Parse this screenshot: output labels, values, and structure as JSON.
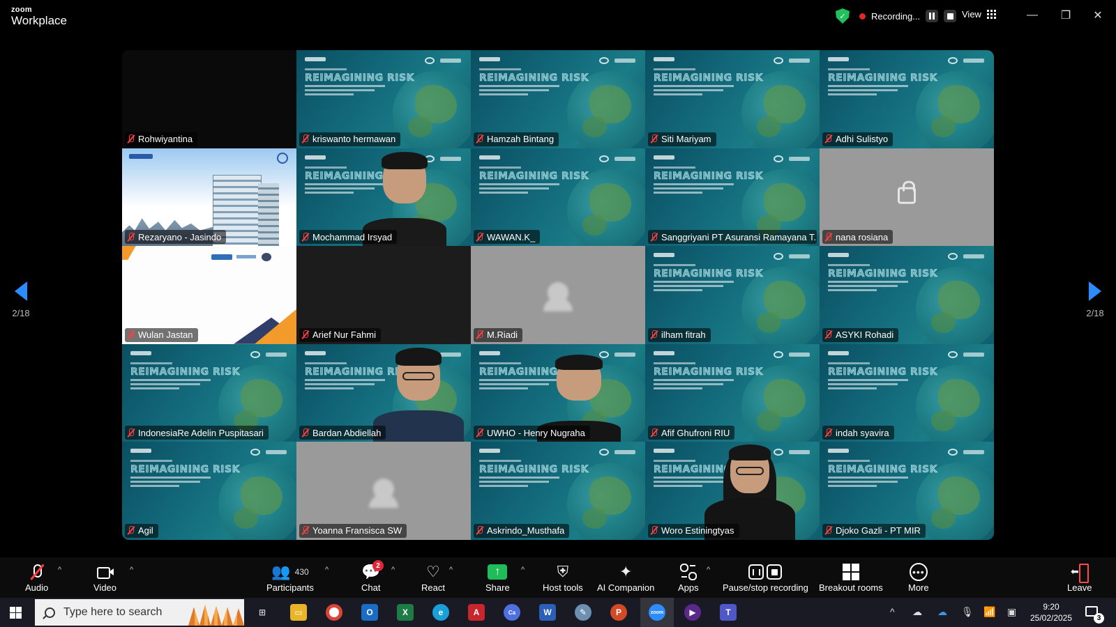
{
  "app": {
    "brand_small": "zoom",
    "brand_big": "Workplace"
  },
  "titlebar": {
    "recording_label": "Recording...",
    "view_label": "View",
    "minimize": "—",
    "restore": "❐",
    "close": "✕"
  },
  "pagination": {
    "left_label": "2/18",
    "right_label": "2/18"
  },
  "participants": [
    {
      "name": "Rohwiyantina",
      "tile": "black"
    },
    {
      "name": "kriswanto hermawan",
      "tile": "slide"
    },
    {
      "name": "Hamzah Bintang",
      "tile": "slide"
    },
    {
      "name": "Siti Mariyam",
      "tile": "slide"
    },
    {
      "name": "Adhi Sulistyo",
      "tile": "slide"
    },
    {
      "name": "Rezaryano - Jasindo",
      "tile": "building"
    },
    {
      "name": "Mochammad Irsyad",
      "tile": "slide-person"
    },
    {
      "name": "WAWAN.K_",
      "tile": "slide"
    },
    {
      "name": "Sanggriyani PT Asuransi Ramayana T...",
      "tile": "slide"
    },
    {
      "name": "nana rosiana",
      "tile": "gray-lock"
    },
    {
      "name": "Wulan Jastan",
      "tile": "white"
    },
    {
      "name": "Arief Nur Fahmi",
      "tile": "dark"
    },
    {
      "name": "M.Riadi",
      "tile": "gray-avatar"
    },
    {
      "name": "ilham fitrah",
      "tile": "slide"
    },
    {
      "name": "ASYKI Rohadi",
      "tile": "slide"
    },
    {
      "name": "IndonesiaRe Adelin Puspitasari",
      "tile": "slide"
    },
    {
      "name": "Bardan Abdiellah",
      "tile": "slide-person"
    },
    {
      "name": "UWHO - Henry Nugraha",
      "tile": "slide-person"
    },
    {
      "name": "Afif Ghufroni RIU",
      "tile": "slide"
    },
    {
      "name": "indah syavira",
      "tile": "slide"
    },
    {
      "name": "Agil",
      "tile": "slide"
    },
    {
      "name": "Yoanna Fransisca SW",
      "tile": "gray-avatar"
    },
    {
      "name": "Askrindo_Musthafa",
      "tile": "slide"
    },
    {
      "name": "Woro Estiningtyas",
      "tile": "slide-person"
    },
    {
      "name": "Djoko Gazli - PT MIR",
      "tile": "slide"
    }
  ],
  "slide": {
    "heading": "REIMAGINING RISK"
  },
  "toolbar": {
    "audio": "Audio",
    "video": "Video",
    "participants": "Participants",
    "participants_count": "430",
    "chat": "Chat",
    "chat_badge": "2",
    "react": "React",
    "share": "Share",
    "host_tools": "Host tools",
    "ai_companion": "AI Companion",
    "apps": "Apps",
    "pause_stop": "Pause/stop recording",
    "breakout": "Breakout rooms",
    "more": "More",
    "leave": "Leave"
  },
  "taskbar": {
    "search_placeholder": "Type here to search",
    "time": "9:20",
    "date": "25/02/2025",
    "notification_count": "3"
  },
  "colors": {
    "accent_blue": "#2a8cff",
    "recording_red": "#e02828",
    "share_green": "#1fbd5a",
    "mute_red": "#ff4040"
  }
}
